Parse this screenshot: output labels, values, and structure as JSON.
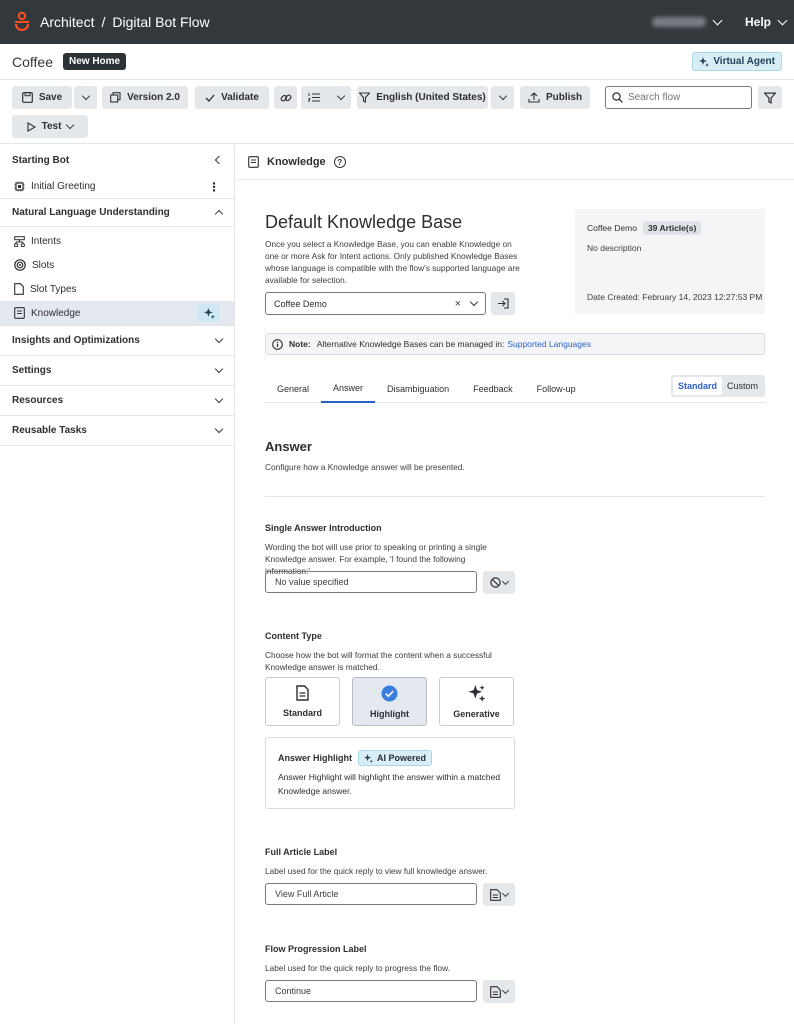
{
  "header": {
    "app": "Architect",
    "flow_type": "Digital Bot Flow",
    "help": "Help"
  },
  "flow": {
    "name": "Coffee",
    "badge": "New Home",
    "virtual_agent": "Virtual Agent"
  },
  "toolbar": {
    "save": "Save",
    "version": "Version 2.0",
    "validate": "Validate",
    "language": "English (United States)",
    "publish": "Publish",
    "search_placeholder": "Search flow",
    "test": "Test"
  },
  "sidebar": {
    "starting_bot": "Starting Bot",
    "initial_greeting": "Initial Greeting",
    "nlu": "Natural Language Understanding",
    "nlu_items": [
      {
        "label": "Intents"
      },
      {
        "label": "Slots"
      },
      {
        "label": "Slot Types"
      },
      {
        "label": "Knowledge"
      }
    ],
    "sections": [
      {
        "label": "Insights and Optimizations"
      },
      {
        "label": "Settings"
      },
      {
        "label": "Resources"
      },
      {
        "label": "Reusable Tasks"
      }
    ]
  },
  "panel": {
    "title": "Knowledge",
    "kb_title": "Default Knowledge Base",
    "kb_desc": "Once you select a Knowledge Base, you can enable Knowledge on one or more Ask for Intent actions. Only published Knowledge Bases whose language is compatible with the flow's supported language are available for selection.",
    "kb_selected": "Coffee Demo",
    "info": {
      "name": "Coffee Demo",
      "articles": "39 Article(s)",
      "description": "No description",
      "date": "Date Created: February 14, 2023 12:27:53 PM"
    },
    "note_label": "Note:",
    "note_text": "Alternative Knowledge Bases can be managed in:",
    "note_link": "Supported Languages",
    "tabs": [
      {
        "label": "General"
      },
      {
        "label": "Answer"
      },
      {
        "label": "Disambiguation"
      },
      {
        "label": "Feedback"
      },
      {
        "label": "Follow-up"
      }
    ],
    "mode_standard": "Standard",
    "mode_custom": "Custom",
    "answer_title": "Answer",
    "answer_desc": "Configure how a Knowledge answer will be presented.",
    "intro_title": "Single Answer Introduction",
    "intro_desc": "Wording the bot will use prior to speaking or printing a single Knowledge answer. For example, 'I found the following information:'",
    "intro_value": "No value specified",
    "content_title": "Content Type",
    "content_desc": "Choose how the bot will format the content when a successful Knowledge answer is matched.",
    "content_types": [
      {
        "label": "Standard"
      },
      {
        "label": "Highlight"
      },
      {
        "label": "Generative"
      }
    ],
    "highlight_title": "Answer Highlight",
    "highlight_badge": "AI Powered",
    "highlight_desc": "Answer Highlight will highlight the answer within a matched Knowledge answer.",
    "full_title": "Full Article Label",
    "full_desc": "Label used for the quick reply to view full knowledge answer.",
    "full_value": "View Full Article",
    "prog_title": "Flow Progression Label",
    "prog_desc": "Label used for the quick reply to progress the flow.",
    "prog_value": "Continue"
  }
}
